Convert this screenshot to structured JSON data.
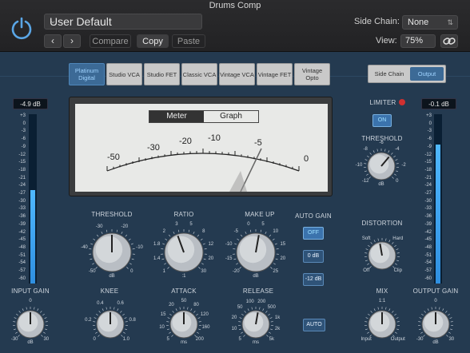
{
  "header": {
    "title": "Drums Comp",
    "preset": "User Default",
    "compare": "Compare",
    "copy": "Copy",
    "paste": "Paste",
    "side_chain_label": "Side Chain:",
    "side_chain_value": "None",
    "view_label": "View:",
    "view_value": "75%"
  },
  "modes": [
    "Platinum Digital",
    "Studio VCA",
    "Studio FET",
    "Classic VCA",
    "Vintage VCA",
    "Vintage FET",
    "Vintage Opto"
  ],
  "selected_mode": "Platinum Digital",
  "output_select": {
    "side_chain": "Side Chain",
    "output": "Output",
    "selected": "Output"
  },
  "input_meter": {
    "value": "-4.9 dB",
    "scale": [
      "+3",
      "0",
      "-3",
      "-6",
      "-9",
      "-12",
      "-15",
      "-18",
      "-21",
      "-24",
      "-27",
      "-30",
      "-33",
      "-36",
      "-39",
      "-42",
      "-45",
      "-48",
      "-51",
      "-54",
      "-57",
      "-60"
    ],
    "level": 0.55
  },
  "output_meter": {
    "value": "-0.1 dB",
    "scale": [
      "+3",
      "0",
      "-3",
      "-6",
      "-9",
      "-12",
      "-15",
      "-18",
      "-21",
      "-24",
      "-27",
      "-30",
      "-33",
      "-36",
      "-39",
      "-42",
      "-45",
      "-48",
      "-51",
      "-54",
      "-57",
      "-60"
    ],
    "level": 0.82
  },
  "vu_meter": {
    "tabs": [
      "Meter",
      "Graph"
    ],
    "selected_tab": "Meter",
    "scale": [
      "-50",
      "-30",
      "-20",
      "-10",
      "-5",
      "0"
    ]
  },
  "limiter": {
    "label": "LIMITER",
    "button": "ON",
    "threshold_label": "THRESHOLD",
    "threshold_ticks": [
      "-8",
      "-6",
      "-4",
      "-10",
      "-2",
      "-12",
      "0"
    ],
    "unit": "dB"
  },
  "distortion": {
    "label": "DISTORTION",
    "options": [
      "Soft",
      "Hard",
      "Off",
      "Clip"
    ]
  },
  "mix": {
    "label": "MIX",
    "top": "1:1",
    "left": "Input",
    "right": "Output"
  },
  "output_gain": {
    "label": "OUTPUT GAIN",
    "ticks": [
      "0",
      "-30",
      "30"
    ],
    "unit": "dB"
  },
  "input_gain": {
    "label": "INPUT GAIN",
    "ticks": [
      "0",
      "-30",
      "30"
    ],
    "unit": "dB"
  },
  "threshold": {
    "label": "THRESHOLD",
    "ticks": [
      "-30",
      "-20",
      "-40",
      "-10",
      "-50",
      "0"
    ],
    "unit": "dB"
  },
  "ratio": {
    "label": "RATIO",
    "ticks": [
      "3",
      "5",
      "2",
      "8",
      "12",
      "1.8",
      "20",
      "1.4",
      "30",
      "1",
      "30"
    ],
    "unit": ":1"
  },
  "makeup": {
    "label": "MAKE UP",
    "ticks": [
      "0",
      "5",
      "-5",
      "10",
      "-10",
      "15",
      "-15",
      "20",
      "-20",
      "25"
    ],
    "unit": "dB"
  },
  "knee": {
    "label": "KNEE",
    "ticks": [
      "0.4",
      "0.6",
      "0.2",
      "0.8",
      "0",
      "1.0"
    ]
  },
  "attack": {
    "label": "ATTACK",
    "ticks": [
      "20",
      "50",
      "80",
      "15",
      "120",
      "10",
      "160",
      "5",
      "200"
    ],
    "unit": "ms"
  },
  "release": {
    "label": "RELEASE",
    "ticks": [
      "100",
      "200",
      "50",
      "500",
      "20",
      "1k",
      "10",
      "2k",
      "5",
      "5k"
    ],
    "unit": "ms"
  },
  "auto_gain": {
    "label": "AUTO GAIN",
    "options": [
      "OFF",
      "0 dB",
      "-12 dB"
    ],
    "selected": "OFF"
  },
  "auto_release": "AUTO"
}
